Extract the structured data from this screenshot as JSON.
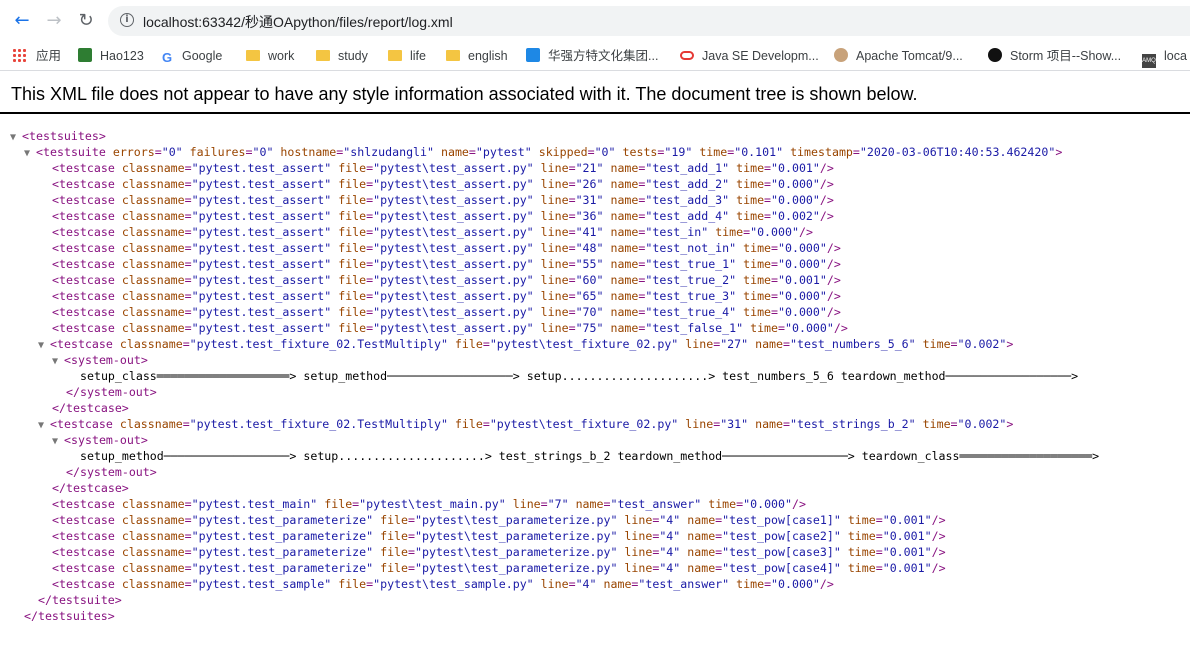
{
  "browser": {
    "url": "localhost:63342/秒通OApython/files/report/log.xml",
    "bookmarks": [
      {
        "label": "应用",
        "icon": "apps-grid-icon"
      },
      {
        "label": "Hao123",
        "icon": "hao123-icon"
      },
      {
        "label": "Google",
        "icon": "google-icon"
      },
      {
        "label": "work",
        "icon": "folder-icon"
      },
      {
        "label": "study",
        "icon": "folder-icon"
      },
      {
        "label": "life",
        "icon": "folder-icon"
      },
      {
        "label": "english",
        "icon": "folder-icon"
      },
      {
        "label": "华强方特文化集团...",
        "icon": "fantawild-icon"
      },
      {
        "label": "Java SE Developm...",
        "icon": "oracle-icon"
      },
      {
        "label": "Apache Tomcat/9...",
        "icon": "tomcat-icon"
      },
      {
        "label": "Storm 项目--Show...",
        "icon": "storm-icon"
      },
      {
        "label": "loca",
        "icon": "amq-icon"
      }
    ]
  },
  "page": {
    "notice": "This XML file does not appear to have any style information associated with it. The document tree is shown below."
  },
  "xml": {
    "root_open": "<testsuites>",
    "root_close": "</testsuites>",
    "suite": {
      "errors": "0",
      "failures": "0",
      "hostname": "shlzudangli",
      "name": "pytest",
      "skipped": "0",
      "tests": "19",
      "time": "0.101",
      "timestamp": "2020-03-06T10:40:53.462420",
      "close": "</testsuite>"
    },
    "assert_cases": [
      {
        "classname": "pytest.test_assert",
        "file": "pytest\\test_assert.py",
        "line": "21",
        "name": "test_add_1",
        "time": "0.001"
      },
      {
        "classname": "pytest.test_assert",
        "file": "pytest\\test_assert.py",
        "line": "26",
        "name": "test_add_2",
        "time": "0.000"
      },
      {
        "classname": "pytest.test_assert",
        "file": "pytest\\test_assert.py",
        "line": "31",
        "name": "test_add_3",
        "time": "0.000"
      },
      {
        "classname": "pytest.test_assert",
        "file": "pytest\\test_assert.py",
        "line": "36",
        "name": "test_add_4",
        "time": "0.002"
      },
      {
        "classname": "pytest.test_assert",
        "file": "pytest\\test_assert.py",
        "line": "41",
        "name": "test_in",
        "time": "0.000"
      },
      {
        "classname": "pytest.test_assert",
        "file": "pytest\\test_assert.py",
        "line": "48",
        "name": "test_not_in",
        "time": "0.000"
      },
      {
        "classname": "pytest.test_assert",
        "file": "pytest\\test_assert.py",
        "line": "55",
        "name": "test_true_1",
        "time": "0.000"
      },
      {
        "classname": "pytest.test_assert",
        "file": "pytest\\test_assert.py",
        "line": "60",
        "name": "test_true_2",
        "time": "0.001"
      },
      {
        "classname": "pytest.test_assert",
        "file": "pytest\\test_assert.py",
        "line": "65",
        "name": "test_true_3",
        "time": "0.000"
      },
      {
        "classname": "pytest.test_assert",
        "file": "pytest\\test_assert.py",
        "line": "70",
        "name": "test_true_4",
        "time": "0.000"
      },
      {
        "classname": "pytest.test_assert",
        "file": "pytest\\test_assert.py",
        "line": "75",
        "name": "test_false_1",
        "time": "0.000"
      }
    ],
    "fixture_cases": [
      {
        "classname": "pytest.test_fixture_02.TestMultiply",
        "file": "pytest\\test_fixture_02.py",
        "line": "27",
        "name": "test_numbers_5_6",
        "time": "0.002",
        "system_out": "setup_class═══════════════════> setup_method──────────────────> setup.....................> test_numbers_5_6 teardown_method──────────────────>"
      },
      {
        "classname": "pytest.test_fixture_02.TestMultiply",
        "file": "pytest\\test_fixture_02.py",
        "line": "31",
        "name": "test_strings_b_2",
        "time": "0.002",
        "system_out": "setup_method──────────────────> setup.....................> test_strings_b_2 teardown_method──────────────────> teardown_class═══════════════════>"
      }
    ],
    "other_cases": [
      {
        "classname": "pytest.test_main",
        "file": "pytest\\test_main.py",
        "line": "7",
        "name": "test_answer",
        "time": "0.000"
      },
      {
        "classname": "pytest.test_parameterize",
        "file": "pytest\\test_parameterize.py",
        "line": "4",
        "name": "test_pow[case1]",
        "time": "0.001"
      },
      {
        "classname": "pytest.test_parameterize",
        "file": "pytest\\test_parameterize.py",
        "line": "4",
        "name": "test_pow[case2]",
        "time": "0.001"
      },
      {
        "classname": "pytest.test_parameterize",
        "file": "pytest\\test_parameterize.py",
        "line": "4",
        "name": "test_pow[case3]",
        "time": "0.001"
      },
      {
        "classname": "pytest.test_parameterize",
        "file": "pytest\\test_parameterize.py",
        "line": "4",
        "name": "test_pow[case4]",
        "time": "0.001"
      },
      {
        "classname": "pytest.test_sample",
        "file": "pytest\\test_sample.py",
        "line": "4",
        "name": "test_answer",
        "time": "0.000"
      }
    ],
    "system_out_open": "<system-out>",
    "system_out_close": "</system-out>",
    "testcase_close": "</testcase>",
    "toggle_glyph": "▼"
  }
}
